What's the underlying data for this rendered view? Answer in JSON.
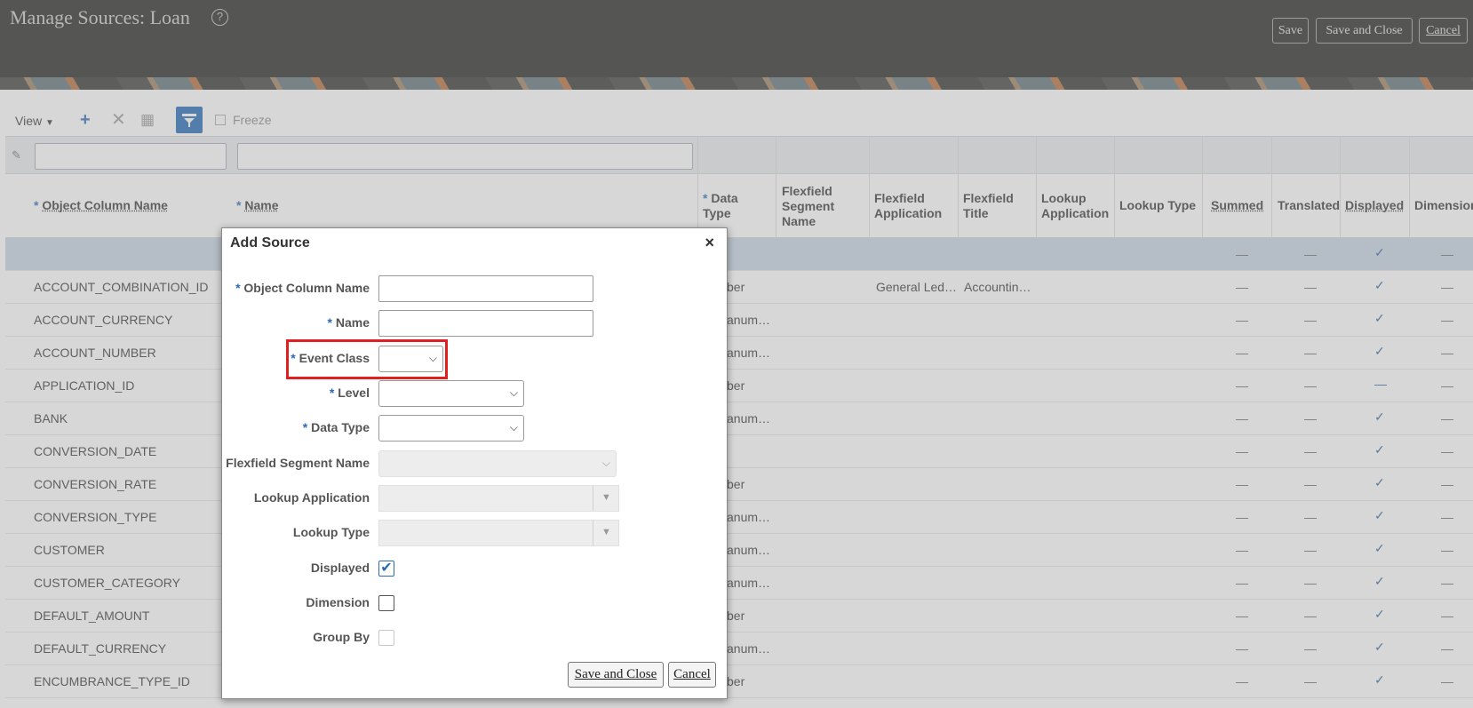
{
  "header": {
    "title": "Manage Sources: Loan",
    "save_label": "Save",
    "save_close_label": "Save and Close",
    "cancel_label": "Cancel"
  },
  "toolbar": {
    "view_label": "View",
    "freeze_label": "Freeze"
  },
  "table": {
    "columns": [
      "Object Column Name",
      "Name",
      "Data Type",
      "Flexfield Segment Name",
      "Flexfield Application",
      "Flexfield Title",
      "Lookup Application",
      "Lookup Type",
      "Summed",
      "Translated",
      "Displayed",
      "Dimension"
    ],
    "rows": [
      {
        "object_column": "",
        "data_type": "",
        "ff_app": "",
        "ff_title": "",
        "summed": "—",
        "translated": "—",
        "displayed": "✓",
        "dimension": "—"
      },
      {
        "object_column": "ACCOUNT_COMBINATION_ID",
        "data_type": "ber",
        "ff_app": "General Led…",
        "ff_title": "Accountin…",
        "summed": "—",
        "translated": "—",
        "displayed": "✓",
        "dimension": "—"
      },
      {
        "object_column": "ACCOUNT_CURRENCY",
        "data_type": "anum…",
        "ff_app": "",
        "ff_title": "",
        "summed": "—",
        "translated": "—",
        "displayed": "✓",
        "dimension": "—"
      },
      {
        "object_column": "ACCOUNT_NUMBER",
        "data_type": "anum…",
        "ff_app": "",
        "ff_title": "",
        "summed": "—",
        "translated": "—",
        "displayed": "✓",
        "dimension": "—"
      },
      {
        "object_column": "APPLICATION_ID",
        "data_type": "ber",
        "ff_app": "",
        "ff_title": "",
        "summed": "—",
        "translated": "—",
        "displayed": "—",
        "dimension": "—"
      },
      {
        "object_column": "BANK",
        "data_type": "anum…",
        "ff_app": "",
        "ff_title": "",
        "summed": "—",
        "translated": "—",
        "displayed": "✓",
        "dimension": "—"
      },
      {
        "object_column": "CONVERSION_DATE",
        "data_type": "",
        "ff_app": "",
        "ff_title": "",
        "summed": "—",
        "translated": "—",
        "displayed": "✓",
        "dimension": "—"
      },
      {
        "object_column": "CONVERSION_RATE",
        "data_type": "ber",
        "ff_app": "",
        "ff_title": "",
        "summed": "—",
        "translated": "—",
        "displayed": "✓",
        "dimension": "—"
      },
      {
        "object_column": "CONVERSION_TYPE",
        "data_type": "anum…",
        "ff_app": "",
        "ff_title": "",
        "summed": "—",
        "translated": "—",
        "displayed": "✓",
        "dimension": "—"
      },
      {
        "object_column": "CUSTOMER",
        "data_type": "anum…",
        "ff_app": "",
        "ff_title": "",
        "summed": "—",
        "translated": "—",
        "displayed": "✓",
        "dimension": "—"
      },
      {
        "object_column": "CUSTOMER_CATEGORY",
        "data_type": "anum…",
        "ff_app": "",
        "ff_title": "",
        "summed": "—",
        "translated": "—",
        "displayed": "✓",
        "dimension": "—"
      },
      {
        "object_column": "DEFAULT_AMOUNT",
        "data_type": "ber",
        "ff_app": "",
        "ff_title": "",
        "summed": "—",
        "translated": "—",
        "displayed": "✓",
        "dimension": "—"
      },
      {
        "object_column": "DEFAULT_CURRENCY",
        "data_type": "anum…",
        "ff_app": "",
        "ff_title": "",
        "summed": "—",
        "translated": "—",
        "displayed": "✓",
        "dimension": "—"
      },
      {
        "object_column": "ENCUMBRANCE_TYPE_ID",
        "data_type": "ber",
        "ff_app": "",
        "ff_title": "",
        "summed": "—",
        "translated": "—",
        "displayed": "✓",
        "dimension": "—"
      }
    ]
  },
  "dialog": {
    "title": "Add Source",
    "close_icon": "×",
    "fields": {
      "object_column_name": "Object Column Name",
      "name": "Name",
      "event_class": "Event Class",
      "level": "Level",
      "data_type": "Data Type",
      "flexfield_segment_name": "Flexfield Segment Name",
      "lookup_application": "Lookup Application",
      "lookup_type": "Lookup Type",
      "displayed": "Displayed",
      "dimension": "Dimension",
      "group_by": "Group By"
    },
    "values": {
      "displayed": true,
      "dimension": false,
      "group_by": false
    },
    "save_close_label": "Save and Close",
    "cancel_label": "Cancel"
  },
  "colors": {
    "header_bg": "#1f1f1d",
    "accent": "#2d6ab1",
    "highlight": "#e02020"
  }
}
